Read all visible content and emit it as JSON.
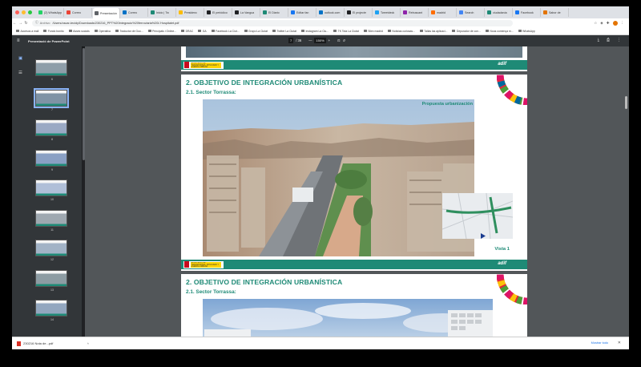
{
  "browser": {
    "tabs": [
      {
        "label": "(2) WhatsApp",
        "color": "#25d366"
      },
      {
        "label": "Correo",
        "color": "#ea4335"
      },
      {
        "label": "Presentación",
        "color": "#5f6368",
        "active": true
      },
      {
        "label": "Correo",
        "color": "#0072c6"
      },
      {
        "label": "Inicio | Tw",
        "color": "#1e8a76"
      },
      {
        "label": "Presidenc",
        "color": "#fbbc04"
      },
      {
        "label": "El periódico",
        "color": "#202124"
      },
      {
        "label": "La Vangua",
        "color": "#202124"
      },
      {
        "label": "El Diario",
        "color": "#1e8a76"
      },
      {
        "label": "Editar fan",
        "color": "#1877f2"
      },
      {
        "label": "outlook.com",
        "color": "#0072c6"
      },
      {
        "label": "El projecte",
        "color": "#202124"
      },
      {
        "label": "Tweetdeck",
        "color": "#1da1f2"
      },
      {
        "label": "Rebuscant",
        "color": "#8e24aa"
      },
      {
        "label": "madrid",
        "color": "#ff6d00"
      },
      {
        "label": "Search",
        "color": "#4285f4"
      },
      {
        "label": "ciudadanía",
        "color": "#1e8a76"
      },
      {
        "label": "Facebook",
        "color": "#1877f2"
      },
      {
        "label": "Sabor de",
        "color": "#e37400"
      }
    ],
    "url_scheme": "Archivo",
    "url": "/Users/oscar-tecidy/Downloads/230216_PPT%20Integracio%20ferroviaria%20L'Hospitalet.pdf",
    "bookmarks": [
      "Accesos a mail",
      "Fondo bonito",
      "Asses sociais",
      "Operativa",
      "Traductor de Goo...",
      "Principals i Online...",
      "DRAC",
      "GA",
      "Facebook La Ciut...",
      "Grupo La Ciutat",
      "Twitter La Ciutat",
      "Instagram La Ciu...",
      "TK Tota La Ciutat",
      "Silex madrid",
      "Noticias curiosas...",
      "Tallas las aplicaci...",
      "Depurador de con...",
      "Nous comença m...",
      "WhatsApp"
    ]
  },
  "pdf": {
    "doc_title": "Presentació de PowerPoint",
    "page_current": "7",
    "page_total": "/ 36",
    "zoom": "150%",
    "thumbnails": [
      "6",
      "7",
      "8",
      "9",
      "10",
      "11",
      "12",
      "13",
      "14"
    ],
    "selected_thumbnail": "7"
  },
  "slide1": {
    "title": "2. OBJETIVO DE INTEGRACIÓN URBANÍSTICA",
    "subtitle": "2.1. Sector Torrassa:",
    "overlay_label": "Propuesta urbanización",
    "view_label": "Vista 1"
  },
  "slide2": {
    "title": "2. OBJETIVO DE INTEGRACIÓN URBANÍSTICA",
    "subtitle": "2.1. Sector Torrassa:"
  },
  "footer": {
    "adif": "adif",
    "ministry": "MINISTERIO DE TRANSPORTES, MOVILIDAD Y AGENDA URBANA"
  },
  "download": {
    "filename": "230216 Nota de...pdf",
    "show_all": "Mostrar todo"
  },
  "colors": {
    "adif_green": "#1e8a76",
    "pdf_toolbar": "#323639"
  }
}
